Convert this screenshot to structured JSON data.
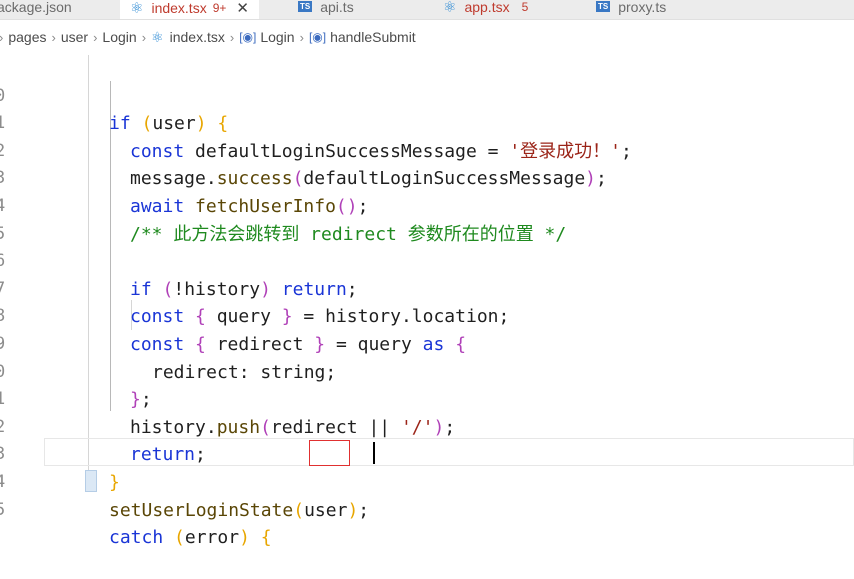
{
  "tabs": [
    {
      "label": "ackage.json",
      "icon": "json-icon",
      "active": false
    },
    {
      "label": "index.tsx",
      "sub": "9+",
      "icon": "react-icon",
      "active": true
    },
    {
      "label": "api.ts",
      "icon": "ts-icon",
      "active": false
    },
    {
      "label": "app.tsx",
      "sub": "5",
      "icon": "react-icon",
      "active": false
    },
    {
      "label": "proxy.ts",
      "icon": "ts-icon",
      "active": false
    }
  ],
  "breadcrumb": {
    "items": [
      "pages",
      "user",
      "Login",
      "index.tsx",
      "Login",
      "handleSubmit"
    ]
  },
  "colors": {
    "keyword": "#1a35d6",
    "string": "#9b2418",
    "comment": "#1f8a1f",
    "modified_tab": "#bf3b2e",
    "highlight_box": "#e03030"
  },
  "editor": {
    "line_numbers": [
      "0",
      "1",
      "2",
      "3",
      "4",
      "5",
      "6",
      "7",
      "8",
      "9",
      "0",
      "1",
      "2",
      "3",
      "4",
      "5"
    ],
    "lines": [
      {
        "t1": "if",
        "t2": "user"
      },
      {
        "t1": "const",
        "t2": "defaultLoginSuccessMessage = ",
        "t3": "'登录成功！'",
        "t4": ";"
      },
      {
        "t1": "message.",
        "t2": "success",
        "t3": "defaultLoginSuccessMessage",
        "t4": ";"
      },
      {
        "t1": "await",
        "t2": "fetchUserInfo",
        "t3": ";"
      },
      {
        "t1": "/** 此方法会跳转到 redirect 参数所在的位置 */"
      },
      {},
      {
        "t1": "if",
        "t2": "!history",
        "t3": "return",
        "t4": ";"
      },
      {
        "t1": "const",
        "t2": "query",
        "t3": " = history.location;"
      },
      {
        "t1": "const",
        "t2": "redirect",
        "t3": " = query ",
        "t4": "as"
      },
      {
        "t1": "redirect: string;"
      },
      {
        "t1": ";"
      },
      {
        "t1": "history.",
        "t2": "push",
        "t3": "redirect || ",
        "t4": "'/'",
        "t5": ";"
      },
      {
        "t1": "return",
        "t2": ";"
      },
      {},
      {
        "t1": "setUserLoginState",
        "t2": "user",
        "t3": ";"
      },
      {
        "t1": "catch",
        "t2": "error"
      }
    ]
  }
}
